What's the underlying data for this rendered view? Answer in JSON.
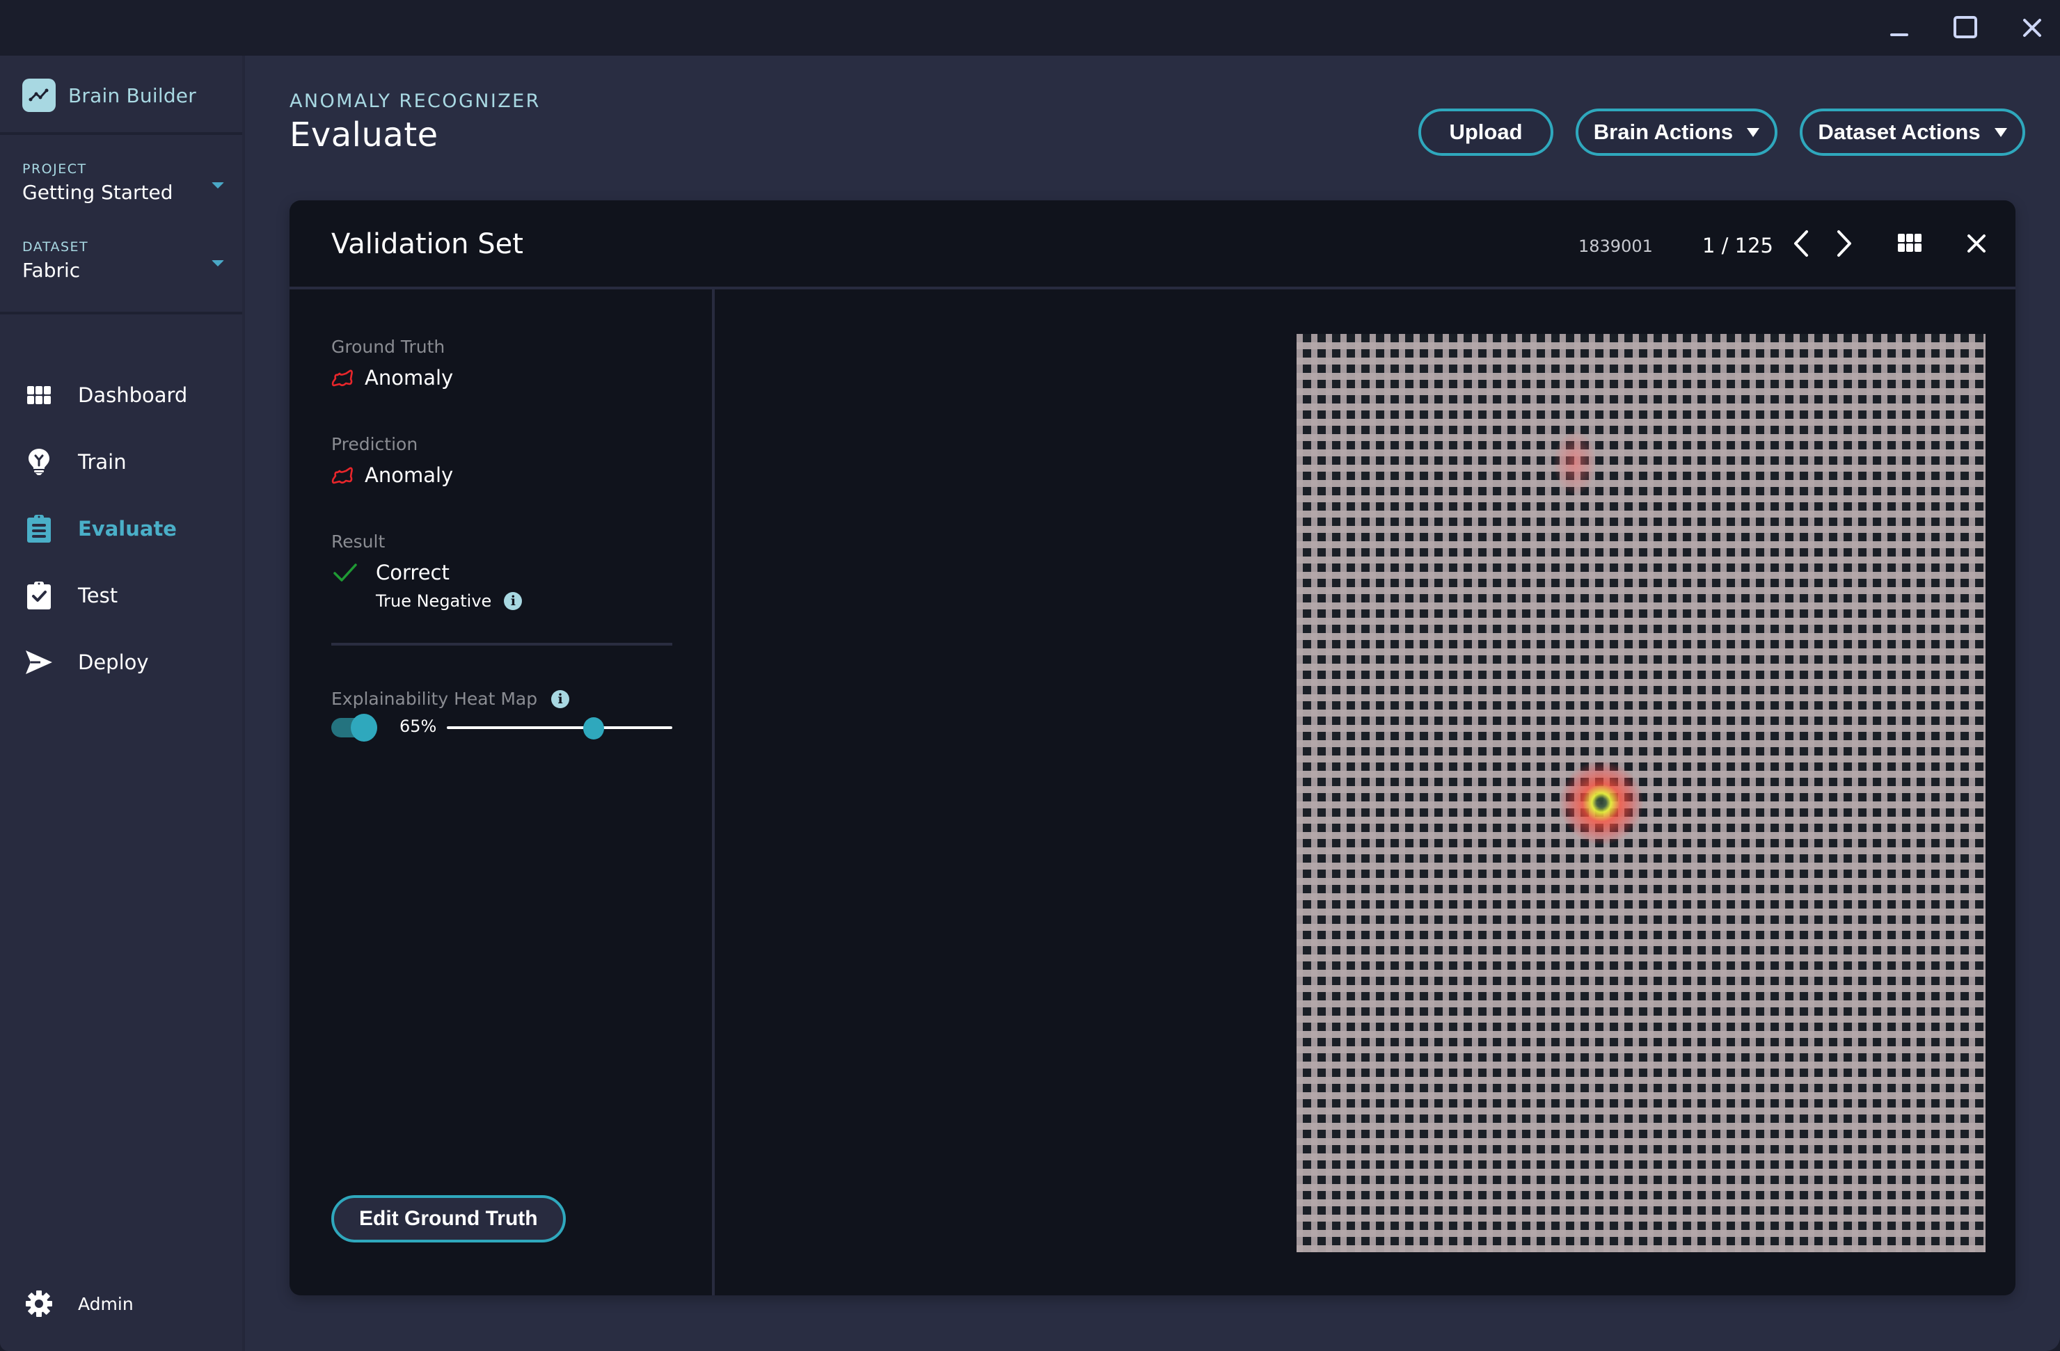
{
  "window": {
    "controls": [
      "minimize-icon",
      "maximize-icon",
      "close-icon"
    ]
  },
  "sidebar": {
    "brand": {
      "name": "Brain Builder",
      "icon": "trend-line-icon"
    },
    "project": {
      "label": "PROJECT",
      "value": "Getting Started"
    },
    "dataset": {
      "label": "DATASET",
      "value": "Fabric"
    },
    "nav": [
      {
        "label": "Dashboard",
        "icon": "grid-icon",
        "active": false
      },
      {
        "label": "Train",
        "icon": "lightbulb-icon",
        "active": false
      },
      {
        "label": "Evaluate",
        "icon": "clipboard-list-icon",
        "active": true
      },
      {
        "label": "Test",
        "icon": "clipboard-check-icon",
        "active": false
      },
      {
        "label": "Deploy",
        "icon": "send-icon",
        "active": false
      }
    ],
    "admin": {
      "label": "Admin",
      "icon": "gear-icon"
    }
  },
  "header": {
    "eyebrow": "ANOMALY RECOGNIZER",
    "title": "Evaluate",
    "actions": {
      "upload": "Upload",
      "brain_actions": "Brain Actions",
      "dataset_actions": "Dataset Actions"
    }
  },
  "panel": {
    "title": "Validation Set",
    "sample_id": "1839001",
    "pager": "1 / 125",
    "ground_truth": {
      "label": "Ground Truth",
      "value": "Anomaly"
    },
    "prediction": {
      "label": "Prediction",
      "value": "Anomaly"
    },
    "result": {
      "label": "Result",
      "value": "Correct",
      "detail": "True Negative"
    },
    "heat_map": {
      "label": "Explainability Heat Map",
      "enabled": true,
      "opacity_percent": 65,
      "opacity_label": "65%"
    },
    "edit_button": "Edit Ground Truth"
  },
  "colors": {
    "accent": "#2fa8bd",
    "active_nav": "#4aafc8",
    "anomaly": "#e8262b",
    "correct": "#1f9a34",
    "info": "#a8d8e2"
  }
}
